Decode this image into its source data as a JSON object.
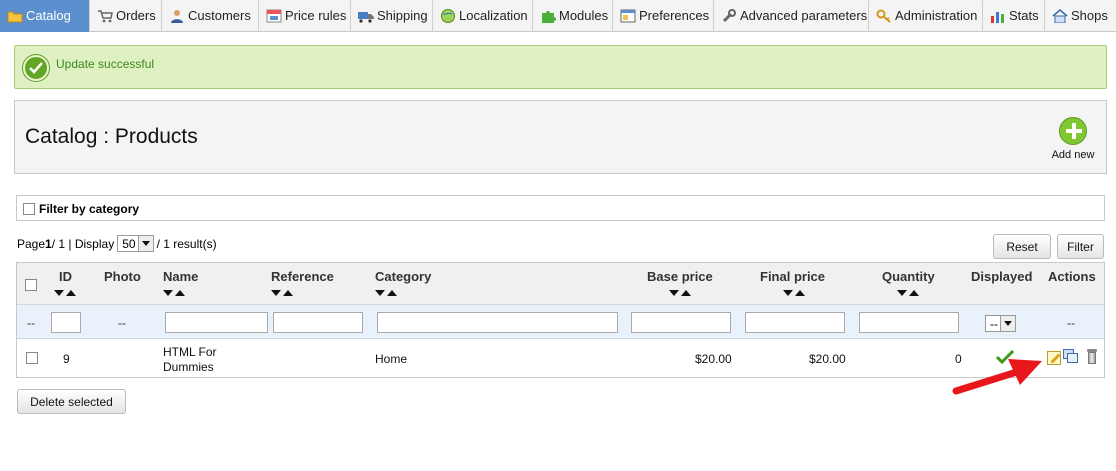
{
  "nav": {
    "tabs": [
      {
        "label": "Catalog",
        "icon": "folder-icon",
        "active": true
      },
      {
        "label": "Orders",
        "icon": "cart-icon"
      },
      {
        "label": "Customers",
        "icon": "users-icon"
      },
      {
        "label": "Price rules",
        "icon": "price-tag-icon"
      },
      {
        "label": "Shipping",
        "icon": "truck-icon"
      },
      {
        "label": "Localization",
        "icon": "globe-icon"
      },
      {
        "label": "Modules",
        "icon": "puzzle-icon"
      },
      {
        "label": "Preferences",
        "icon": "window-icon"
      },
      {
        "label": "Advanced parameters",
        "icon": "wrench-icon"
      },
      {
        "label": "Administration",
        "icon": "key-icon"
      },
      {
        "label": "Stats",
        "icon": "bar-chart-icon"
      },
      {
        "label": "Shops",
        "icon": "house-icon"
      }
    ]
  },
  "alert": {
    "message": "Update successful",
    "color": "#3c8a1c"
  },
  "page": {
    "title": "Catalog : Products",
    "add_new_label": "Add new"
  },
  "filter_category": {
    "label": "Filter by category"
  },
  "pagination": {
    "page_prefix": "Page ",
    "page_current": "1",
    "page_total": " / 1 | Display ",
    "per_page": "50",
    "result_text": " / 1 result(s)"
  },
  "buttons": {
    "reset": "Reset",
    "filter": "Filter",
    "delete_selected": "Delete selected"
  },
  "table": {
    "headers": {
      "id": "ID",
      "photo": "Photo",
      "name": "Name",
      "reference": "Reference",
      "category": "Category",
      "base_price": "Base price",
      "final_price": "Final price",
      "quantity": "Quantity",
      "displayed": "Displayed",
      "actions": "Actions"
    },
    "filter_row": {
      "dash": "--",
      "displayed_select": "--"
    },
    "rows": [
      {
        "id": "9",
        "name_line1": "HTML For",
        "name_line2": "Dummies",
        "category": "Home",
        "base_price": "$20.00",
        "final_price": "$20.00",
        "quantity": "0",
        "displayed": true
      }
    ]
  },
  "annotation": {
    "arrow_color": "#e8171b"
  },
  "colors": {
    "accent": "#5b8fce",
    "success_bg": "#dff0c2"
  }
}
